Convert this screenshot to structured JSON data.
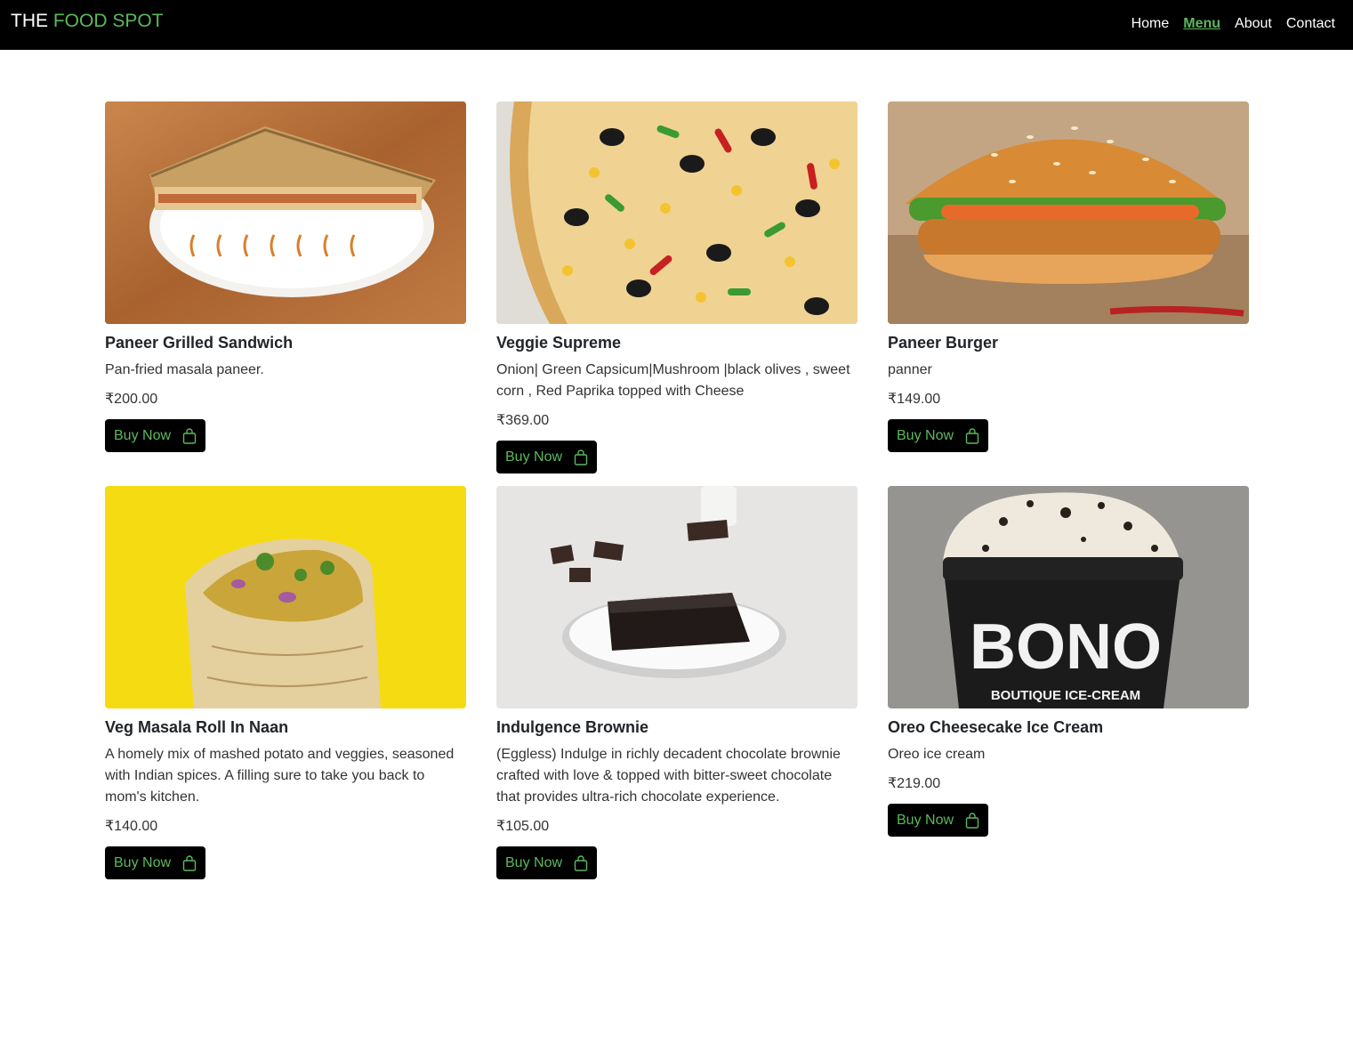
{
  "nav": {
    "brand_prefix": "THE",
    "brand_accent": "FOOD SPOT",
    "links": [
      "Home",
      "Menu",
      "About",
      "Contact"
    ],
    "active": "Menu"
  },
  "colors": {
    "accent": "#5cb85c",
    "nav_bg": "#000000"
  },
  "cards": [
    {
      "title": "Paneer Grilled Sandwich",
      "desc": "Pan-fried masala paneer.",
      "price": "₹200.00",
      "button": "Buy Now",
      "image": "sandwich-image"
    },
    {
      "title": "Veggie Supreme",
      "desc": "Onion| Green Capsicum|Mushroom |black olives , sweet corn , Red Paprika topped with Cheese",
      "price": "₹369.00",
      "button": "Buy Now",
      "image": "pizza-image"
    },
    {
      "title": "Paneer Burger",
      "desc": "panner",
      "price": "₹149.00",
      "button": "Buy Now",
      "image": "burger-image"
    },
    {
      "title": "Veg Masala Roll In Naan",
      "desc": "A homely mix of mashed potato and veggies, seasoned with Indian spices. A filling sure to take you back to mom's kitchen.",
      "price": "₹140.00",
      "button": "Buy Now",
      "image": "roll-image"
    },
    {
      "title": "Indulgence Brownie",
      "desc": "(Eggless) Indulge in richly decadent chocolate brownie crafted with love & topped with bitter-sweet chocolate that provides ultra-rich chocolate experience.",
      "price": "₹105.00",
      "button": "Buy Now",
      "image": "brownie-image"
    },
    {
      "title": "Oreo Cheesecake Ice Cream",
      "desc": "Oreo ice cream",
      "price": "₹219.00",
      "button": "Buy Now",
      "image": "ice-cream-image",
      "cup_brand": "BONO",
      "cup_tagline": "BOUTIQUE ICE-CREAM"
    }
  ]
}
